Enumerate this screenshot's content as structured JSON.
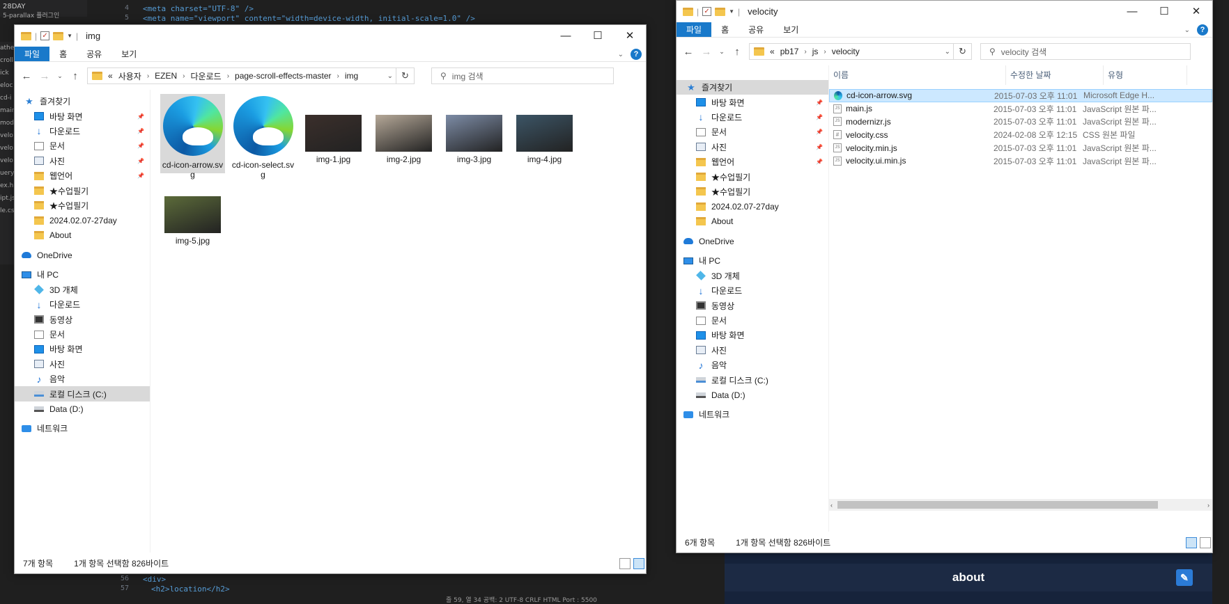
{
  "editor": {
    "top_label": "28DAY",
    "sub_label": "5-parallax 플러그인",
    "sidebar_fragments": [
      "ather",
      "croll",
      "ick",
      "eloc",
      "cd-i",
      "main",
      "mod",
      "velo",
      "velo",
      "velo",
      "uery",
      "ex.h",
      "ipt.js",
      "le.cs"
    ],
    "line_numbers": [
      "4",
      "5",
      "56",
      "57"
    ],
    "code_line_4": "<meta charset=\"UTF-8\" />",
    "code_line_5": "<meta name=\"viewport\" content=\"width=device-width, initial-scale=1.0\" />",
    "code_line_56": "<div>",
    "code_line_57": "<h2>location</h2>",
    "preview_label": "about",
    "status_text": "줄 59, 열 34   공백: 2   UTF-8   CRLF   HTML   Port : 5500"
  },
  "left_window": {
    "title": "img",
    "ribbon_tabs": [
      "파일",
      "홈",
      "공유",
      "보기"
    ],
    "breadcrumb": [
      "사용자",
      "EZEN",
      "다운로드",
      "page-scroll-effects-master",
      "img"
    ],
    "breadcrumb_prefix": "«",
    "search_placeholder": "img 검색",
    "nav_items": [
      {
        "label": "즐겨찾기",
        "icon": "star-icon"
      },
      {
        "label": "바탕 화면",
        "icon": "desktop-icon",
        "pinned": true
      },
      {
        "label": "다운로드",
        "icon": "download-icon",
        "pinned": true
      },
      {
        "label": "문서",
        "icon": "document-icon",
        "pinned": true
      },
      {
        "label": "사진",
        "icon": "pictures-icon",
        "pinned": true
      },
      {
        "label": "웹언어",
        "icon": "folder-icon",
        "pinned": true
      },
      {
        "label": "★수업필기",
        "icon": "folder-icon"
      },
      {
        "label": "★수업필기",
        "icon": "folder-icon"
      },
      {
        "label": "2024.02.07-27day",
        "icon": "folder-icon"
      },
      {
        "label": "About",
        "icon": "folder-icon"
      },
      {
        "label": "OneDrive",
        "icon": "onedrive-icon"
      },
      {
        "label": "내 PC",
        "icon": "pc-icon"
      },
      {
        "label": "3D 개체",
        "icon": "3d-objects-icon"
      },
      {
        "label": "다운로드",
        "icon": "download-icon"
      },
      {
        "label": "동영상",
        "icon": "video-icon"
      },
      {
        "label": "문서",
        "icon": "document-icon"
      },
      {
        "label": "바탕 화면",
        "icon": "desktop-icon"
      },
      {
        "label": "사진",
        "icon": "pictures-icon"
      },
      {
        "label": "음악",
        "icon": "music-icon"
      },
      {
        "label": "로컬 디스크 (C:)",
        "icon": "local-disk-icon",
        "selected": true
      },
      {
        "label": "Data (D:)",
        "icon": "drive-icon"
      },
      {
        "label": "네트워크",
        "icon": "network-icon"
      }
    ],
    "files": [
      {
        "name": "cd-icon-arrow.svg",
        "kind": "edge",
        "selected": true
      },
      {
        "name": "cd-icon-select.svg",
        "kind": "edge"
      },
      {
        "name": "img-1.jpg",
        "kind": "photo",
        "color": "#3b2f2b"
      },
      {
        "name": "img-2.jpg",
        "kind": "photo",
        "color": "#b5a898"
      },
      {
        "name": "img-3.jpg",
        "kind": "photo",
        "color": "#7d8ca6"
      },
      {
        "name": "img-4.jpg",
        "kind": "photo",
        "color": "#3c5566"
      },
      {
        "name": "img-5.jpg",
        "kind": "photo",
        "color": "#5c6b3a"
      }
    ],
    "status_count": "7개 항목",
    "status_selection": "1개 항목 선택함 826바이트"
  },
  "right_window": {
    "title": "velocity",
    "ribbon_tabs": [
      "파일",
      "홈",
      "공유",
      "보기"
    ],
    "breadcrumb": [
      "pb17",
      "js",
      "velocity"
    ],
    "breadcrumb_prefix": "«",
    "search_placeholder": "velocity 검색",
    "nav_items": [
      {
        "label": "즐겨찾기",
        "icon": "star-icon",
        "selected": true
      },
      {
        "label": "바탕 화면",
        "icon": "desktop-icon",
        "pinned": true
      },
      {
        "label": "다운로드",
        "icon": "download-icon",
        "pinned": true
      },
      {
        "label": "문서",
        "icon": "document-icon",
        "pinned": true
      },
      {
        "label": "사진",
        "icon": "pictures-icon",
        "pinned": true
      },
      {
        "label": "웹언어",
        "icon": "folder-icon",
        "pinned": true
      },
      {
        "label": "★수업필기",
        "icon": "folder-icon"
      },
      {
        "label": "★수업필기",
        "icon": "folder-icon"
      },
      {
        "label": "2024.02.07-27day",
        "icon": "folder-icon"
      },
      {
        "label": "About",
        "icon": "folder-icon"
      },
      {
        "label": "OneDrive",
        "icon": "onedrive-icon"
      },
      {
        "label": "내 PC",
        "icon": "pc-icon"
      },
      {
        "label": "3D 개체",
        "icon": "3d-objects-icon"
      },
      {
        "label": "다운로드",
        "icon": "download-icon"
      },
      {
        "label": "동영상",
        "icon": "video-icon"
      },
      {
        "label": "문서",
        "icon": "document-icon"
      },
      {
        "label": "바탕 화면",
        "icon": "desktop-icon"
      },
      {
        "label": "사진",
        "icon": "pictures-icon"
      },
      {
        "label": "음악",
        "icon": "music-icon"
      },
      {
        "label": "로컬 디스크 (C:)",
        "icon": "local-disk-icon"
      },
      {
        "label": "Data (D:)",
        "icon": "drive-icon"
      },
      {
        "label": "네트워크",
        "icon": "network-icon"
      }
    ],
    "columns": [
      "이름",
      "수정한 날짜",
      "유형"
    ],
    "rows": [
      {
        "name": "cd-icon-arrow.svg",
        "date": "2015-07-03 오후 11:01",
        "type": "Microsoft Edge H...",
        "icon": "svg",
        "selected": true
      },
      {
        "name": "main.js",
        "date": "2015-07-03 오후 11:01",
        "type": "JavaScript 원본 파...",
        "icon": "js"
      },
      {
        "name": "modernizr.js",
        "date": "2015-07-03 오후 11:01",
        "type": "JavaScript 원본 파...",
        "icon": "js"
      },
      {
        "name": "velocity.css",
        "date": "2024-02-08 오후 12:15",
        "type": "CSS 원본 파일",
        "icon": "css"
      },
      {
        "name": "velocity.min.js",
        "date": "2015-07-03 오후 11:01",
        "type": "JavaScript 원본 파...",
        "icon": "js"
      },
      {
        "name": "velocity.ui.min.js",
        "date": "2015-07-03 오후 11:01",
        "type": "JavaScript 원본 파...",
        "icon": "js"
      }
    ],
    "status_count": "6개 항목",
    "status_selection": "1개 항목 선택함 826바이트"
  }
}
